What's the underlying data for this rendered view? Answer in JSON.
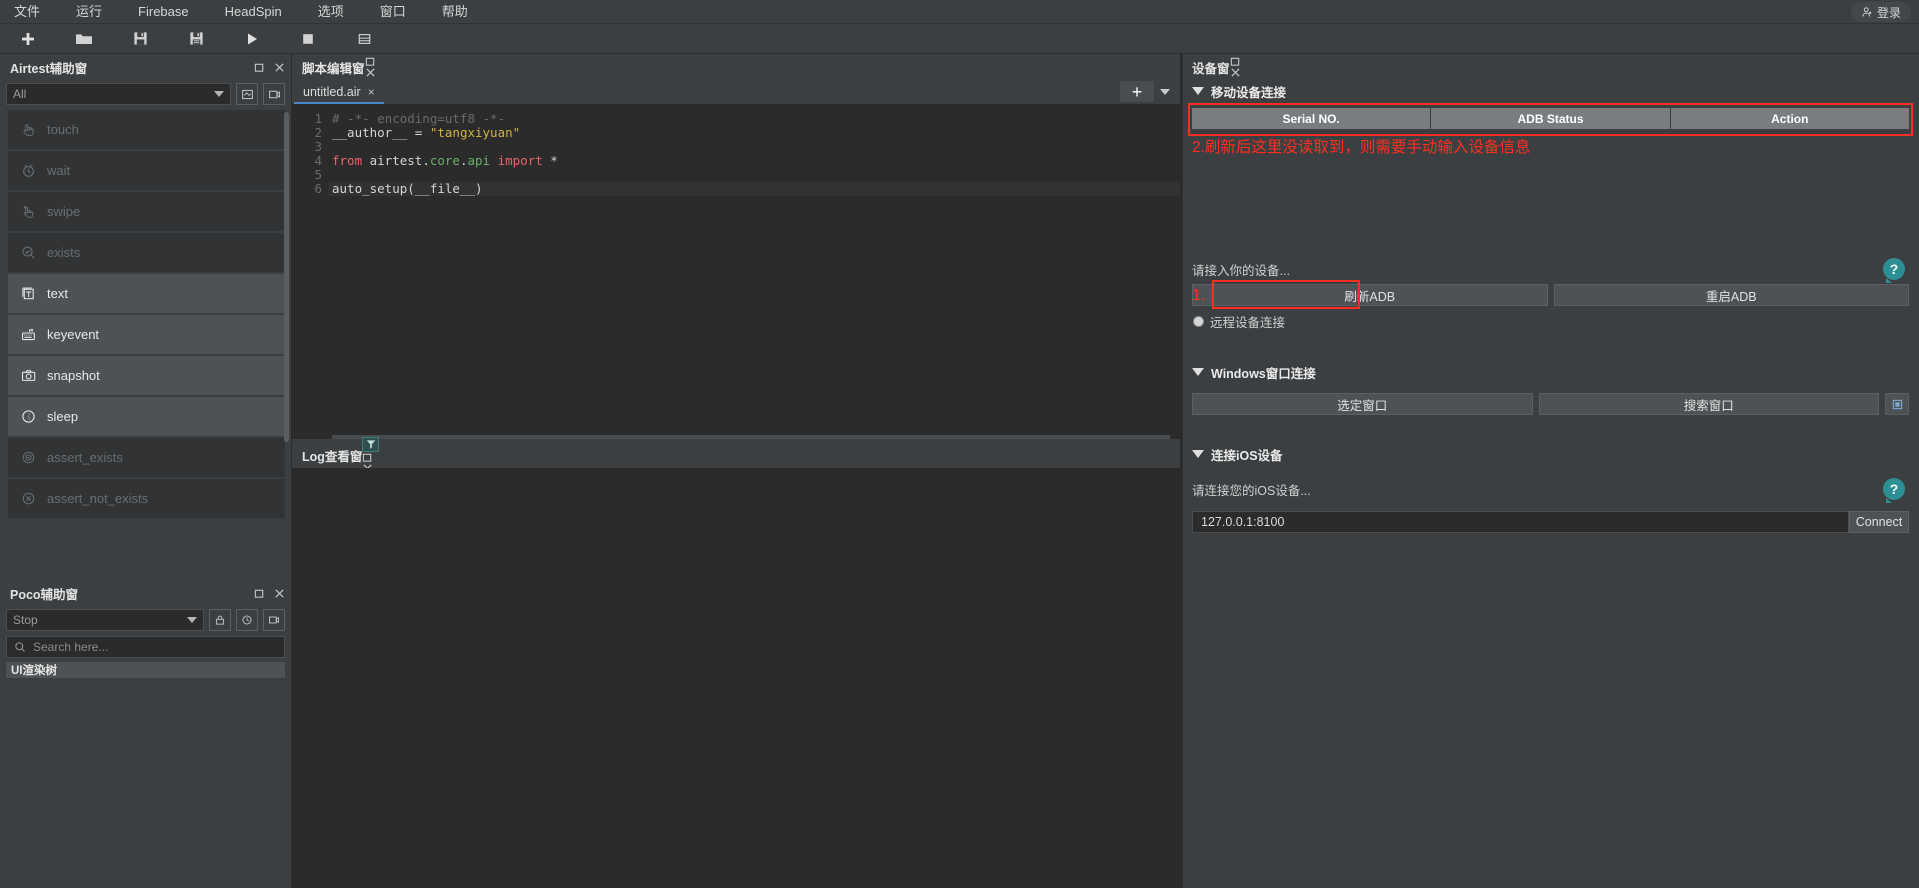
{
  "menubar": {
    "items": [
      {
        "label": "文件"
      },
      {
        "label": "运行"
      },
      {
        "label": "Firebase"
      },
      {
        "label": "HeadSpin"
      },
      {
        "label": "选项"
      },
      {
        "label": "窗口"
      },
      {
        "label": "帮助"
      }
    ],
    "login_label": "登录",
    "login_icon": "user-icon"
  },
  "toolbar": {
    "buttons": [
      {
        "name": "new-icon",
        "glyph": "plus"
      },
      {
        "name": "open-folder-icon",
        "glyph": "folder"
      },
      {
        "name": "save-icon",
        "glyph": "save"
      },
      {
        "name": "save-as-icon",
        "glyph": "save-as"
      },
      {
        "name": "run-icon",
        "glyph": "play"
      },
      {
        "name": "stop-icon",
        "glyph": "stop"
      },
      {
        "name": "report-icon",
        "glyph": "report"
      }
    ]
  },
  "airtest_panel": {
    "title": "Airtest辅助窗",
    "filter_value": "All",
    "window_buttons": [
      "restore",
      "close"
    ],
    "side_buttons": [
      "screenshot-select-icon",
      "record-icon"
    ],
    "commands": [
      {
        "label": "touch",
        "icon": "hand-touch-icon",
        "enabled": false
      },
      {
        "label": "wait",
        "icon": "clock-icon",
        "enabled": false
      },
      {
        "label": "swipe",
        "icon": "swipe-hand-icon",
        "enabled": false
      },
      {
        "label": "exists",
        "icon": "magnifier-check-icon",
        "enabled": false
      },
      {
        "label": "text",
        "icon": "text-box-icon",
        "enabled": true
      },
      {
        "label": "keyevent",
        "icon": "keyboard-icon",
        "enabled": true
      },
      {
        "label": "snapshot",
        "icon": "camera-icon",
        "enabled": true
      },
      {
        "label": "sleep",
        "icon": "moon-icon",
        "enabled": true
      },
      {
        "label": "assert_exists",
        "icon": "target-icon",
        "enabled": false
      },
      {
        "label": "assert_not_exists",
        "icon": "target-x-icon",
        "enabled": false
      }
    ]
  },
  "poco_panel": {
    "title": "Poco辅助窗",
    "mode_value": "Stop",
    "search_placeholder": "Search here...",
    "tree_label": "UI渲染树",
    "buttons": [
      "lock-icon",
      "refresh-icon",
      "record-icon"
    ]
  },
  "editor_panel": {
    "title": "脚本编辑窗",
    "tab": {
      "label": "untitled.air",
      "close": "×"
    },
    "add_button": "+",
    "lines": [
      {
        "n": "1",
        "segments": [
          {
            "t": "# -*- encoding=utf8 -*-",
            "c": "c-comment"
          }
        ]
      },
      {
        "n": "2",
        "segments": [
          {
            "t": "__author__",
            "c": "c-id"
          },
          {
            "t": " = ",
            "c": "c-op"
          },
          {
            "t": "\"tangxiyuan\"",
            "c": "c-str"
          }
        ]
      },
      {
        "n": "3",
        "segments": []
      },
      {
        "n": "4",
        "segments": [
          {
            "t": "from",
            "c": "c-kw2"
          },
          {
            "t": " airtest",
            "c": "c-id"
          },
          {
            "t": ".",
            "c": "c-op"
          },
          {
            "t": "core",
            "c": "c-mod"
          },
          {
            "t": ".",
            "c": "c-op"
          },
          {
            "t": "api ",
            "c": "c-mod"
          },
          {
            "t": "import",
            "c": "c-kw2"
          },
          {
            "t": " *",
            "c": "c-op"
          }
        ]
      },
      {
        "n": "5",
        "segments": []
      },
      {
        "n": "6",
        "segments": [
          {
            "t": "auto_setup(__file__)",
            "c": "c-id"
          }
        ],
        "highlight": true
      }
    ]
  },
  "log_panel": {
    "title": "Log查看窗",
    "buttons": [
      "filter-icon",
      "restore-icon",
      "close-icon"
    ]
  },
  "device_panel": {
    "title": "设备窗",
    "window_buttons": [
      "restore",
      "close"
    ],
    "mobile_section": {
      "heading": "移动设备连接",
      "table_headers": [
        "Serial NO.",
        "ADB Status",
        "Action"
      ],
      "annotation": "2.刷新后这里没读取到，则需要手动输入设备信息",
      "hint": "请接入你的设备...",
      "help_icon": "question-icon",
      "step_marker": "1.",
      "refresh_button": "刷新ADB",
      "restart_button": "重启ADB",
      "remote_radio_label": "远程设备连接"
    },
    "windows_section": {
      "heading": "Windows窗口连接",
      "select_window_button": "选定窗口",
      "search_window_button": "搜索窗口",
      "extra_button_icon": "window-icon"
    },
    "ios_section": {
      "heading": "连接iOS设备",
      "hint": "请连接您的iOS设备...",
      "help_icon": "question-icon",
      "address_value": "127.0.0.1:8100",
      "connect_button": "Connect"
    }
  },
  "colors": {
    "accent_red": "#ff2d20",
    "teal": "#2c8f93",
    "tab_underline": "#4a88c7",
    "panel_bg": "#3c3f41",
    "editor_bg": "#2b2b2b"
  }
}
